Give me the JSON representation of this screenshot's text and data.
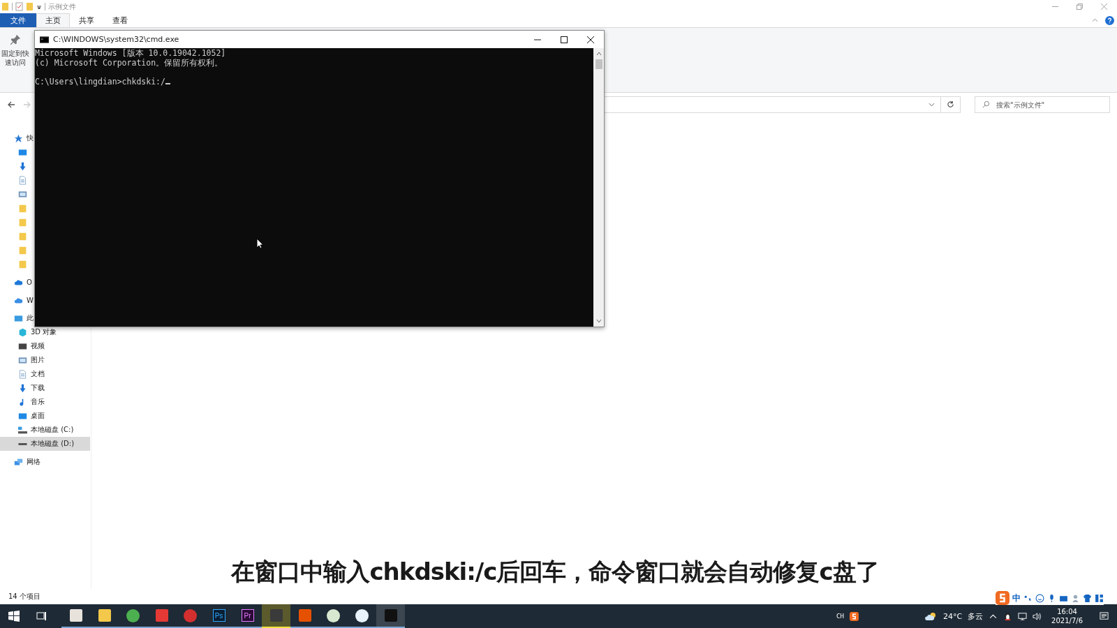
{
  "explorer": {
    "title": "示例文件",
    "ribbon_tabs": [
      {
        "label": "文件",
        "kind": "file",
        "selected": false
      },
      {
        "label": "主页",
        "kind": "tab",
        "selected": true
      },
      {
        "label": "共享",
        "kind": "tab",
        "selected": false
      },
      {
        "label": "查看",
        "kind": "tab",
        "selected": false
      }
    ],
    "pin_button": "固定到快速访问",
    "search": {
      "placeholder": "搜索\"示例文件\""
    },
    "nav": [
      {
        "label": "快",
        "kind": "star",
        "selected": false,
        "children": [
          {
            "kind": "desktop",
            "selected": false
          },
          {
            "kind": "download",
            "selected": false
          },
          {
            "kind": "doc",
            "selected": false
          },
          {
            "kind": "picture",
            "selected": false
          },
          {
            "kind": "folder",
            "selected": false
          },
          {
            "kind": "folder",
            "selected": false
          },
          {
            "kind": "folder",
            "selected": false
          },
          {
            "kind": "folder",
            "selected": false
          },
          {
            "kind": "folder",
            "selected": false
          }
        ]
      },
      {
        "label": "O",
        "kind": "cloud",
        "selected": false
      },
      {
        "label": "W",
        "kind": "cloud2",
        "selected": false
      },
      {
        "label": "此",
        "kind": "pc",
        "selected": false,
        "children": [
          {
            "label": "3D 对象",
            "kind": "cube",
            "selected": false
          },
          {
            "label": "视频",
            "kind": "video",
            "selected": false
          },
          {
            "label": "图片",
            "kind": "picture",
            "selected": false
          },
          {
            "label": "文档",
            "kind": "doc",
            "selected": false
          },
          {
            "label": "下载",
            "kind": "download",
            "selected": false
          },
          {
            "label": "音乐",
            "kind": "music",
            "selected": false
          },
          {
            "label": "桌面",
            "kind": "desktop",
            "selected": false
          },
          {
            "label": "本地磁盘 (C:)",
            "kind": "drivec",
            "selected": false
          },
          {
            "label": "本地磁盘 (D:)",
            "kind": "drive",
            "selected": true
          }
        ]
      },
      {
        "label": "网络",
        "kind": "network",
        "selected": false
      }
    ],
    "status": "14 个项目"
  },
  "cmd": {
    "title": "C:\\WINDOWS\\system32\\cmd.exe",
    "output_lines": [
      "Microsoft Windows [版本 10.0.19042.1052]",
      "(c) Microsoft Corporation。保留所有权利。"
    ],
    "prompt": "C:\\Users\\lingdian>chkdski:/"
  },
  "caption": "在窗口中输入chkdski:/c后回车，命令窗口就会自动修复c盘了",
  "ime_bar": {
    "mode": "中"
  },
  "taskbar": {
    "apps": [
      {
        "kind": "photos",
        "running": true,
        "selected": false
      },
      {
        "kind": "explorer",
        "running": true,
        "selected": false
      },
      {
        "kind": "chrome",
        "running": true,
        "selected": false
      },
      {
        "kind": "wps",
        "running": true,
        "selected": false
      },
      {
        "kind": "netease",
        "running": true,
        "selected": false
      },
      {
        "kind": "ps",
        "label": "Ps",
        "running": true,
        "selected": false
      },
      {
        "kind": "pr",
        "label": "Pr",
        "running": true,
        "selected": false
      },
      {
        "kind": "video",
        "running": true,
        "selected": true
      },
      {
        "kind": "work",
        "running": true,
        "selected": false
      },
      {
        "kind": "notes",
        "running": true,
        "selected": false
      },
      {
        "kind": "acircle",
        "running": true,
        "selected": false
      },
      {
        "kind": "cmd",
        "running": true,
        "selected": false
      }
    ],
    "ime": "CH",
    "temperature": "24°C",
    "weather": "多云",
    "time": "16:04",
    "date": "2021/7/6"
  }
}
